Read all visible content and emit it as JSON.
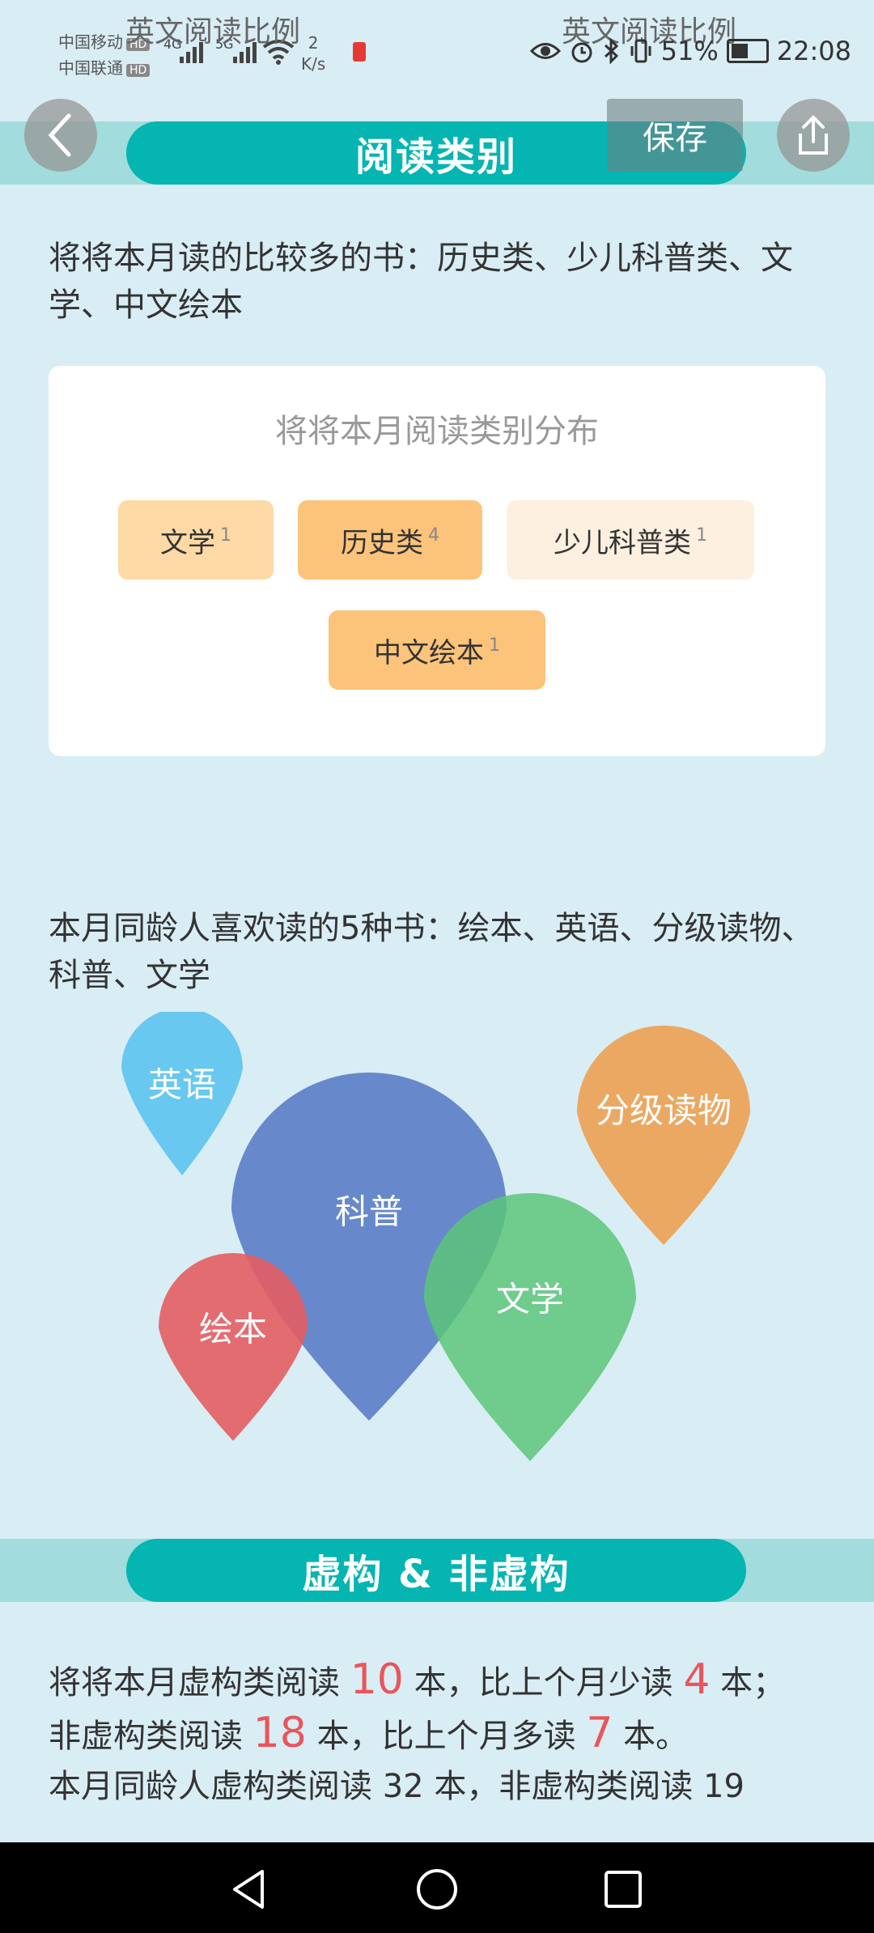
{
  "status_bar": {
    "carrier1": "中国移动",
    "carrier2": "中国联通",
    "hd": "HD",
    "net1": "4G",
    "net2": "5G",
    "speed_value": "2",
    "speed_unit": "K/s",
    "battery": "51%",
    "time": "22:08",
    "ghost_title": "英文阅读比例"
  },
  "toolbar": {
    "save_label": "保存"
  },
  "sections": {
    "category_title": "阅读类别",
    "fiction_title": "虚构 & 非虚构"
  },
  "category": {
    "summary": "将将本月读的比较多的书：历史类、少儿科普类、文学、中文绘本",
    "card_title": "将将本月阅读类别分布",
    "chips": [
      {
        "label": "文学",
        "count": "1",
        "color": "#fdd9a6"
      },
      {
        "label": "历史类",
        "count": "4",
        "color": "#fcc47a"
      },
      {
        "label": "少儿科普类",
        "count": "1",
        "color": "#fef0e0"
      },
      {
        "label": "中文绘本",
        "count": "1",
        "color": "#fcc47a"
      }
    ]
  },
  "peers": {
    "summary": "本月同龄人喜欢读的5种书：绘本、英语、分级读物、科普、文学",
    "bubbles": [
      {
        "label": "英语",
        "color": "#5bc3f0"
      },
      {
        "label": "科普",
        "color": "#5a7dc7"
      },
      {
        "label": "分级读物",
        "color": "#eca052"
      },
      {
        "label": "绘本",
        "color": "#e35d63"
      },
      {
        "label": "文学",
        "color": "#5cc679"
      }
    ]
  },
  "fiction": {
    "line1_prefix": "将将本月虚构类阅读",
    "line1_num1": "10",
    "line1_mid": "本，比上个月少读",
    "line1_num2": "4",
    "line1_suffix": "本；",
    "line2_prefix": "非虚构类阅读",
    "line2_num1": "18",
    "line2_mid": "本，比上个月多读",
    "line2_num2": "7",
    "line2_suffix": "本。",
    "line3": "本月同龄人虚构类阅读 32 本，非虚构类阅读 19"
  }
}
